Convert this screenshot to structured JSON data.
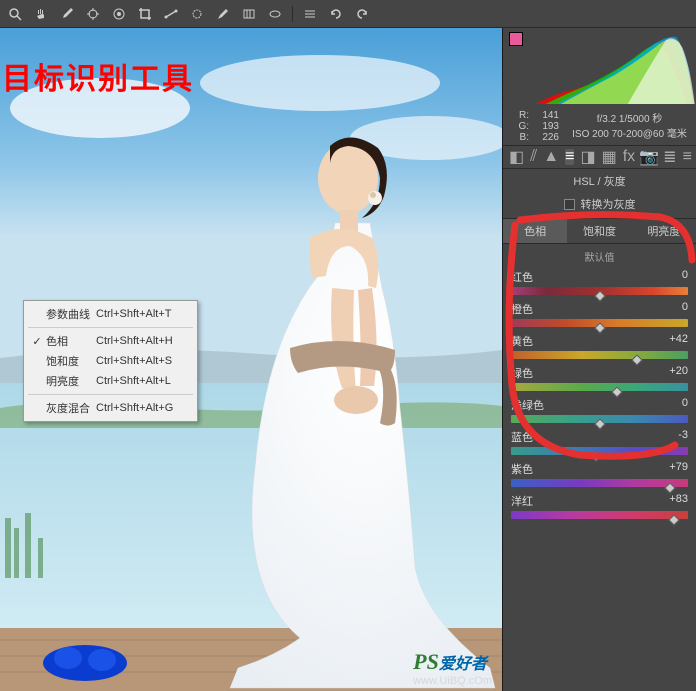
{
  "annotation": {
    "title": "目标识别工具"
  },
  "toolbar": {
    "t1": "zoom",
    "t2": "hand",
    "t3": "wb",
    "t4": "color-sampler",
    "t5": "target-adj",
    "t6": "crop",
    "t7": "straighten",
    "t8": "spot",
    "t9": "redeye",
    "t10": "adj-brush",
    "t11": "grad-filter",
    "t12": "radial",
    "t13": "rotate-ccw",
    "t14": "rotate-cw"
  },
  "context_menu": {
    "items": [
      {
        "label": "参数曲线",
        "shortcut": "Ctrl+Shft+Alt+T",
        "checked": false
      },
      {
        "sep": true
      },
      {
        "label": "色相",
        "shortcut": "Ctrl+Shft+Alt+H",
        "checked": true
      },
      {
        "label": "饱和度",
        "shortcut": "Ctrl+Shft+Alt+S",
        "checked": false
      },
      {
        "label": "明亮度",
        "shortcut": "Ctrl+Shft+Alt+L",
        "checked": false
      },
      {
        "sep": true
      },
      {
        "label": "灰度混合",
        "shortcut": "Ctrl+Shft+Alt+G",
        "checked": false
      }
    ]
  },
  "info": {
    "rgb": {
      "r_lbl": "R:",
      "r": "141",
      "g_lbl": "G:",
      "g": "193",
      "b_lbl": "B:",
      "b": "226"
    },
    "exif": {
      "line1": "f/3.2  1/5000 秒",
      "line2": "ISO 200  70-200@60 毫米"
    }
  },
  "panel": {
    "title": "HSL / 灰度",
    "gray_label": "转换为灰度",
    "tabs": {
      "hue": "色相",
      "sat": "饱和度",
      "lum": "明亮度"
    },
    "default_label": "默认值"
  },
  "sliders": {
    "red": {
      "label": "红色",
      "value": "0",
      "pos": 50
    },
    "orange": {
      "label": "橙色",
      "value": "0",
      "pos": 50
    },
    "yellow": {
      "label": "黄色",
      "value": "+42",
      "pos": 71
    },
    "green": {
      "label": "绿色",
      "value": "+20",
      "pos": 60
    },
    "aqua": {
      "label": "浅绿色",
      "value": "0",
      "pos": 50
    },
    "blue": {
      "label": "蓝色",
      "value": "-3",
      "pos": 48
    },
    "purple": {
      "label": "紫色",
      "value": "+79",
      "pos": 90
    },
    "magenta": {
      "label": "洋红",
      "value": "+83",
      "pos": 92
    }
  },
  "watermark": {
    "ps": "PS",
    "text": "爱好者",
    "url": "www.UiBQ.cOm"
  }
}
